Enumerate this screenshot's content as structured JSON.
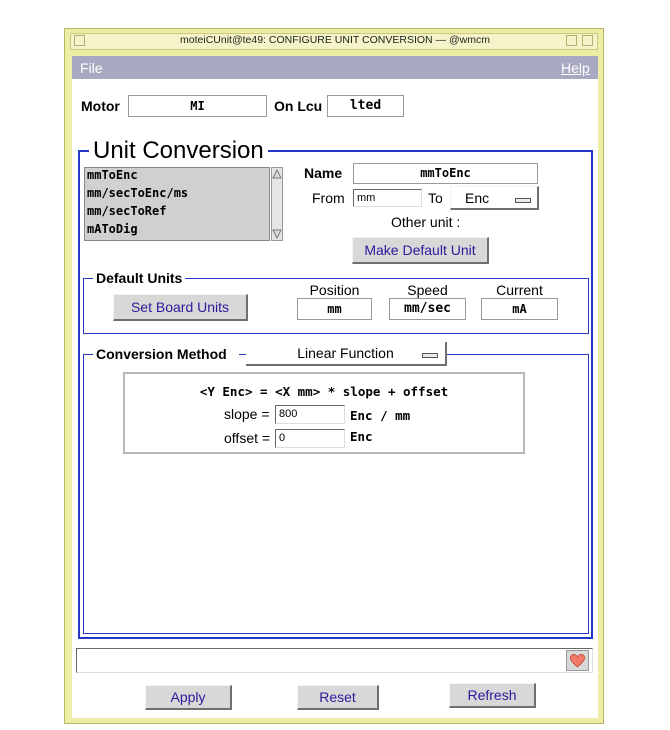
{
  "window": {
    "title": "moteiCUnit@te49: CONFIGURE UNIT CONVERSION — @wmcm"
  },
  "menu": {
    "file": "File",
    "help": "Help"
  },
  "header": {
    "motor_label": "Motor",
    "motor_value": "MI",
    "onlcu_label": "On Lcu",
    "onlcu_value": "lted"
  },
  "unit_conversion": {
    "title": "Unit Conversion",
    "list_items": [
      "mmToEnc",
      "mm/secToEnc/ms",
      "mm/secToRef",
      "mAToDig"
    ],
    "name_label": "Name",
    "name_value": "mmToEnc",
    "from_label": "From",
    "from_value": "mm",
    "to_label": "To",
    "to_value": "Enc",
    "other_unit_label": "Other unit :",
    "make_default_button": "Make Default Unit"
  },
  "default_units": {
    "title": "Default Units",
    "set_board_button": "Set Board Units",
    "position_label": "Position",
    "position_value": "mm",
    "speed_label": "Speed",
    "speed_value": "mm/sec",
    "current_label": "Current",
    "current_value": "mA"
  },
  "conversion_method": {
    "title": "Conversion Method",
    "method_value": "Linear Function",
    "equation": "<Y Enc> = <X mm> * slope + offset",
    "slope_label": "slope =",
    "slope_value": "800",
    "slope_unit": "Enc / mm",
    "offset_label": "offset =",
    "offset_value": "0",
    "offset_unit": "Enc"
  },
  "status": {
    "message": ""
  },
  "buttons": {
    "apply": "Apply",
    "reset": "Reset",
    "refresh": "Refresh"
  },
  "colors": {
    "accent": "#2438c8",
    "menubar": "#a8a8c0",
    "frame": "#ededa6",
    "button_text": "#2a1a9a"
  },
  "icons": {
    "status": "heart-icon"
  }
}
